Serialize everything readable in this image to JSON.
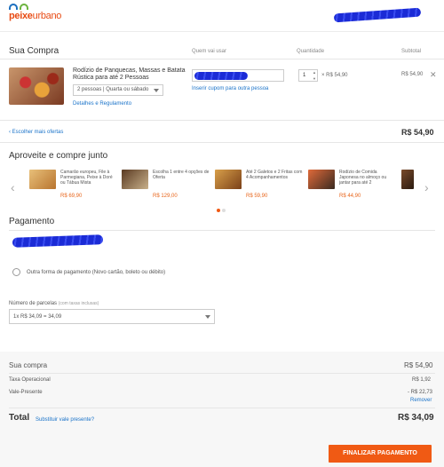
{
  "brand": {
    "logo_text_bold": "peixe",
    "logo_text": "urbano"
  },
  "cart": {
    "title": "Sua Compra",
    "col_who": "Quem vai usar",
    "col_qty": "Quantidade",
    "col_subtotal": "Subtotal",
    "item": {
      "name": "Rodízio de Panquecas, Massas e Batata Rústica para até 2 Pessoas",
      "option": "2 pessoas | Quarta ou sábado",
      "details_link": "Detalhes e Regulamento",
      "coupon_link": "Inserir cupom para outra pessoa",
      "quantity": "1",
      "unit_price": "× R$ 54,90",
      "subtotal": "R$ 54,90"
    },
    "more_offers_link": "Escolher mais ofertas",
    "cart_total": "R$ 54,90"
  },
  "recommendations": {
    "title": "Aproveite e compre junto",
    "items": [
      {
        "text": "Camarão europeu, File à Parmegiana, Peixe à Doré ou Tábua Mista",
        "price": "R$ 69,90"
      },
      {
        "text": "Escolha 1 entre 4 opções de Oferta",
        "price": "R$ 129,00"
      },
      {
        "text": "Até 2 Galetos e 2 Fritas com 4 Acompanhamentos",
        "price": "R$ 59,90"
      },
      {
        "text": "Rodízio de Comida Japonesa no almoço ou jantar para até 2",
        "price": "R$ 44,90"
      }
    ]
  },
  "payment": {
    "title": "Pagamento",
    "other_method": "Outra forma de pagamento (Novo cartão, boleto ou débito)",
    "installments_label": "Número de parcelas",
    "installments_note": "(com taxas inclusas)",
    "installments_value": "1x R$ 34,09 = 34,09"
  },
  "summary": {
    "purchase_label": "Sua compra",
    "purchase_value": "R$ 54,90",
    "fee_label": "Taxa Operacional",
    "fee_value": "R$ 1,92",
    "voucher_label": "Vale-Presente",
    "voucher_value": "- R$ 22,73",
    "remove_link": "Remover",
    "total_label": "Total",
    "replace_voucher_link": "Substituir vale presente?",
    "total_value": "R$ 34,09",
    "finish_button": "FINALIZAR PAGAMENTO"
  }
}
